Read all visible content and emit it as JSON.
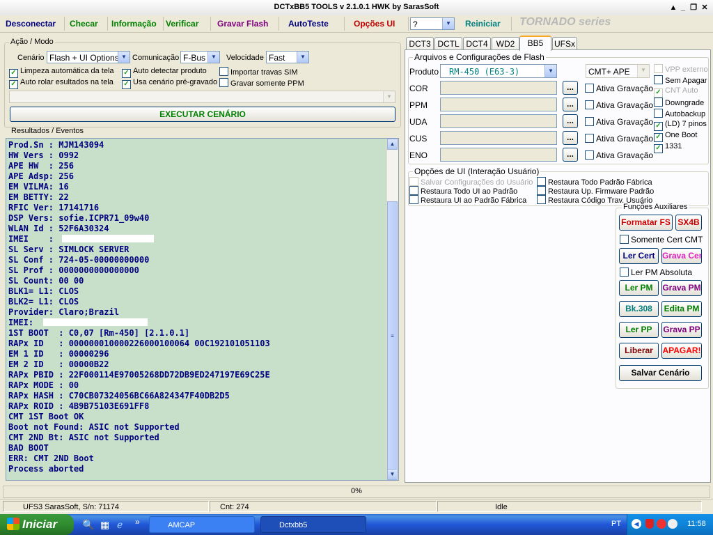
{
  "window": {
    "title": "DCTxBB5 TOOLS v 2.1.0.1 HWK by SarasSoft"
  },
  "menu": {
    "items": [
      "Desconectar",
      "Checar",
      "Informação",
      "Verificar",
      "Gravar Flash",
      "AutoTeste",
      "Opções UI"
    ],
    "colors": [
      "#000080",
      "#008000",
      "#008000",
      "#008000",
      "#800080",
      "#000080",
      "#c00000"
    ],
    "combo_value": "?",
    "reiniciar": "Reiniciar",
    "series": "TORNADO series"
  },
  "acao": {
    "title": "Ação / Modo",
    "cenario_label": "Cenário",
    "cenario_value": "Flash + UI Options",
    "comunicacao_label": "Comunicação",
    "comunicacao_value": "F-Bus",
    "velocidade_label": "Velocidade",
    "velocidade_value": "Fast",
    "checks": [
      {
        "label": "Limpeza automática da tela",
        "checked": true
      },
      {
        "label": "Auto detectar produto",
        "checked": true
      },
      {
        "label": "Importar travas SIM",
        "checked": false
      },
      {
        "label": "Auto rolar esultados na tela",
        "checked": true
      },
      {
        "label": "Usa cenário pré-gravado",
        "checked": true
      },
      {
        "label": "Gravar somente PPM",
        "checked": false
      }
    ],
    "execute": "EXECUTAR CENÁRIO"
  },
  "results": {
    "title": "Resultados / Eventos",
    "lines": [
      "Prod.Sn : MJM143094",
      "HW Vers : 0992",
      "APE HW  : 256",
      "APE Adsp: 256",
      "EM VILMA: 16",
      "EM BETTY: 22",
      "RFIC Ver: 17141716",
      "DSP Vers: sofie.ICPR71_09w40",
      "WLAN Id : 52F6A30324",
      "IMEI    :",
      "SL Serv : SIMLOCK SERVER",
      "SL Conf : 724-05-00000000000",
      "SL Prof : 0000000000000000",
      "SL Count: 00 00",
      "BLK1= L1: CLOS",
      "BLK2= L1: CLOS",
      "Provider: Claro;Brazil",
      "IMEI:",
      "1ST BOOT  : C0,07 [Rm-450] [2.1.0.1]",
      "RAPx ID   : 000000010000226000100064 00C192101051103",
      "EM 1 ID   : 00000296",
      "EM 2 ID   : 00000B22",
      "RAPx PBID : 22F000114E97005268DD72DB9ED247197E69C25E",
      "RAPx MODE : 00",
      "RAPx HASH : C70CB07324056BC66A824347F40DB2D5",
      "RAPx ROID : 4B9B75103E691FF8",
      "CMT 1ST Boot OK",
      "Boot not Found: ASIC not Supported",
      "CMT 2ND Bt: ASIC not Supported",
      "BAD BOOT",
      "ERR: CMT 2ND Boot",
      "Process aborted"
    ]
  },
  "tabs": [
    "DCT3",
    "DCTL",
    "DCT4",
    "WD2",
    "BB5",
    "UFSx"
  ],
  "active_tab": "BB5",
  "flash": {
    "title": "Arquivos e Configurações de Flash",
    "produto_label": "Produto",
    "produto_value": "RM-450  (E63-3)",
    "mode_value": "CMT+ APE",
    "rows": [
      "COR",
      "PPM",
      "UDA",
      "CUS",
      "ENO"
    ],
    "ativa": "Ativa Gravação",
    "dots": "...",
    "right_checks": [
      {
        "label": "VPP externo",
        "checked": false,
        "disabled": true
      },
      {
        "label": "Sem Apagar",
        "checked": false,
        "disabled": false
      },
      {
        "label": "CNT Auto",
        "checked": true,
        "disabled": true
      },
      {
        "label": "Downgrade",
        "checked": false,
        "disabled": false
      },
      {
        "label": "Autobackup",
        "checked": false,
        "disabled": false
      },
      {
        "label": "(LD) 7 pinos",
        "checked": true,
        "disabled": false
      },
      {
        "label": "One Boot",
        "checked": true,
        "disabled": false
      },
      {
        "label": "1331",
        "checked": true,
        "disabled": false
      }
    ]
  },
  "ui_options": {
    "title": "Opções de UI (Interação Usuário)",
    "left": [
      {
        "label": "Salvar Configurações do Usuário",
        "disabled": true
      },
      {
        "label": "Restaura Todo UI ao Padrão",
        "disabled": false
      },
      {
        "label": "Restaura UI ao Padrão Fábrica",
        "disabled": false
      }
    ],
    "right": [
      {
        "label": "Restaura Todo Padrão Fábrica"
      },
      {
        "label": "Restaura Up. Firmware Padrão"
      },
      {
        "label": "Restaura Código Trav. Usuário"
      }
    ]
  },
  "aux": {
    "title": "Funções Auxiliares",
    "formatar": "Formatar FS",
    "sx4b": "SX4B",
    "somente_cmt": "Somente Cert CMT",
    "ler_cert": "Ler Cert",
    "grava_cert": "Grava Cert",
    "ler_pm_abs": "Ler PM Absoluta",
    "ler_pm": "Ler PM",
    "grava_pm": "Grava PM",
    "bk308": "Bk.308",
    "edita_pm": "Edita PM",
    "ler_pp": "Ler PP",
    "grava_pp": "Grava PP",
    "liberar": "Liberar",
    "apagar": "APAGAR!",
    "salvar": "Salvar Cenário"
  },
  "progress": {
    "text": "0%",
    "value": 0
  },
  "status": {
    "serial": "UFS3 SarasSoft, S/n: 71174",
    "cnt": "Cnt: 274",
    "state": "Idle"
  },
  "taskbar": {
    "start": "Iniciar",
    "task1": "AMCAP",
    "task2": "Dctxbb5",
    "lang": "PT",
    "clock": "11:58"
  }
}
